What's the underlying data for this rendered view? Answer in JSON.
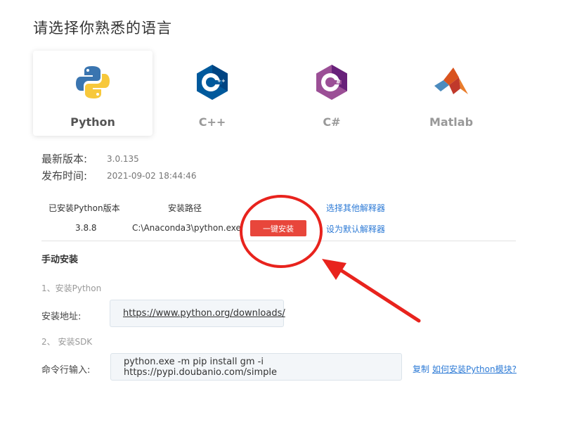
{
  "page": {
    "title": "请选择你熟悉的语言"
  },
  "languages": [
    {
      "name": "Python",
      "selected": true,
      "icon": "python-logo-icon"
    },
    {
      "name": "C++",
      "selected": false,
      "icon": "cpp-logo-icon"
    },
    {
      "name": "C#",
      "selected": false,
      "icon": "csharp-logo-icon"
    },
    {
      "name": "Matlab",
      "selected": false,
      "icon": "matlab-logo-icon"
    }
  ],
  "info": {
    "latest_version_label": "最新版本:",
    "latest_version": "3.0.135",
    "release_time_label": "发布时间:",
    "release_time": "2021-09-02 18:44:46"
  },
  "installed": {
    "headers": {
      "version": "已安装Python版本",
      "path": "安装路径"
    },
    "row": {
      "version": "3.8.8",
      "path": "C:\\Anaconda3\\python.exe"
    },
    "install_button": "一键安装",
    "choose_interpreter": "选择其他解释器",
    "set_default": "设为默认解释器"
  },
  "manual": {
    "title": "手动安装",
    "step1": "1、安装Python",
    "address_label": "安装地址:",
    "address_url": "https://www.python.org/downloads/",
    "step2": "2、 安装SDK",
    "command_label": "命令行输入:",
    "command": "python.exe -m pip install gm -i https://pypi.doubanio.com/simple",
    "copy": "复制",
    "how_to": "如何安装Python模块?"
  },
  "colors": {
    "accent_red": "#e8463b",
    "link_blue": "#2e7bd6",
    "annotation_red": "#e8231d"
  }
}
